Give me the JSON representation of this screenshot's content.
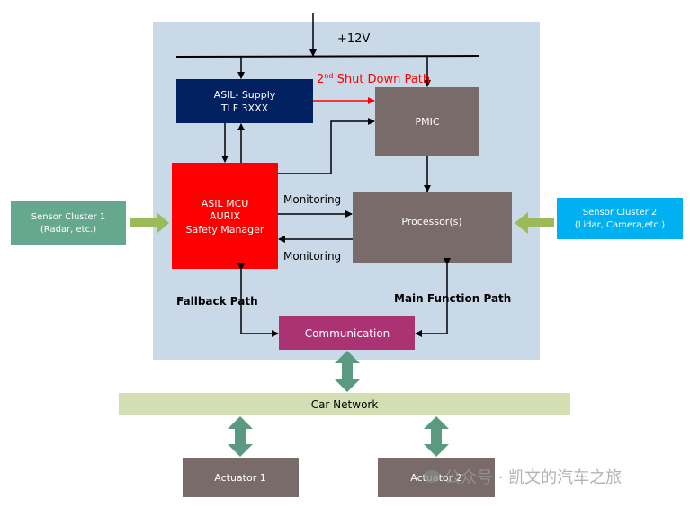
{
  "power": {
    "label": "+12V"
  },
  "blocks": {
    "asil_supply": {
      "line1": "ASIL- Supply",
      "line2": "TLF 3XXX",
      "color": "#002060"
    },
    "pmic": {
      "label": "PMIC",
      "color": "#7a6b6b"
    },
    "mcu": {
      "line1": "ASIL MCU",
      "line2": "AURIX",
      "line3": "Safety Manager",
      "color": "#ff0000"
    },
    "processor": {
      "label": "Processor(s)",
      "color": "#7a6b6b"
    },
    "communication": {
      "label": "Communication",
      "color": "#ab3373"
    },
    "sensor1": {
      "line1": "Sensor Cluster 1",
      "line2": "(Radar, etc.)",
      "color": "#65a78f"
    },
    "sensor2": {
      "line1": "Sensor Cluster 2",
      "line2": "(Lidar, Camera,etc.)",
      "color": "#00b0f0"
    },
    "car_network": {
      "label": "Car Network",
      "color": "#d3deb2"
    },
    "actuator1": {
      "label": "Actuator 1"
    },
    "actuator2": {
      "label": "Actuator 2"
    }
  },
  "labels": {
    "shutdown_main": "Shut Down Path",
    "shutdown_prefix": "2",
    "shutdown_sup": "nd",
    "monitoring_top": "Monitoring",
    "monitoring_bottom": "Monitoring",
    "fallback": "Fallback Path",
    "main_function": "Main Function Path"
  },
  "watermark": "公众号 · 凯文的汽车之旅"
}
